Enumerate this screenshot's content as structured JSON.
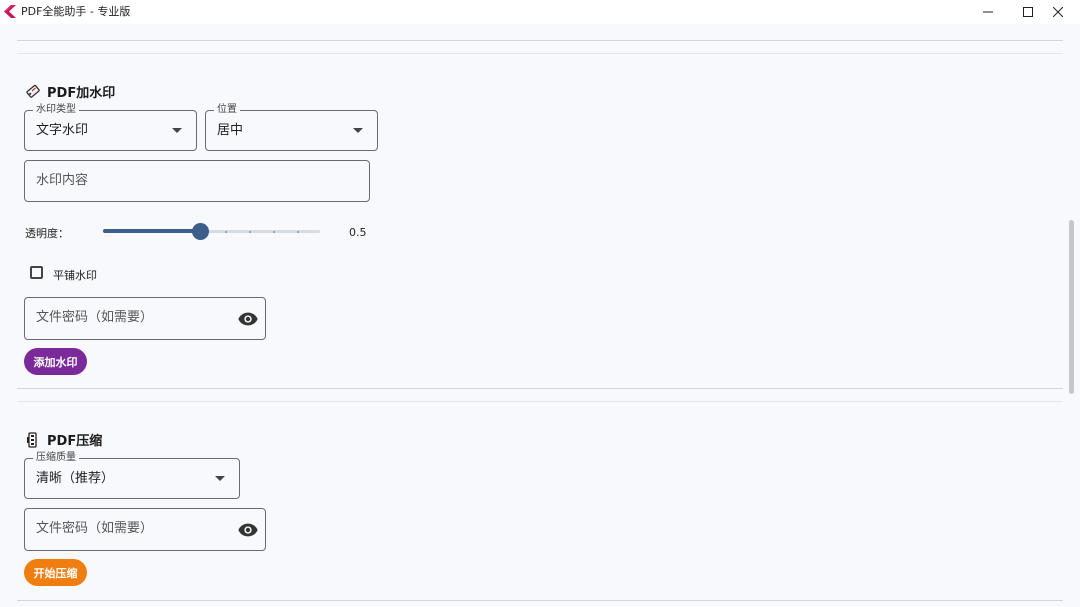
{
  "window": {
    "title": "PDF全能助手 - 专业版"
  },
  "watermark_section": {
    "title": "PDF加水印",
    "icon": "tag-icon",
    "type_field": {
      "label": "水印类型",
      "value": "文字水印"
    },
    "position_field": {
      "label": "位置",
      "value": "居中"
    },
    "content_field": {
      "placeholder": "水印内容"
    },
    "opacity": {
      "label": "透明度：",
      "value": "0.5",
      "fraction": 0.5
    },
    "tile_checkbox": {
      "label": "平铺水印",
      "checked": false
    },
    "password_field": {
      "placeholder": "文件密码（如需要）"
    },
    "submit_button": {
      "label": "添加水印",
      "color": "#7b2a9a"
    }
  },
  "compress_section": {
    "title": "PDF压缩",
    "icon": "clamp-icon",
    "quality_field": {
      "label": "压缩质量",
      "value": "清晰（推荐）"
    },
    "password_field": {
      "placeholder": "文件密码（如需要）"
    },
    "submit_button": {
      "label": "开始压缩",
      "color": "#f07d10"
    }
  },
  "colors": {
    "background": "#f8f9fc",
    "slider_accent": "#3d5f8c"
  }
}
